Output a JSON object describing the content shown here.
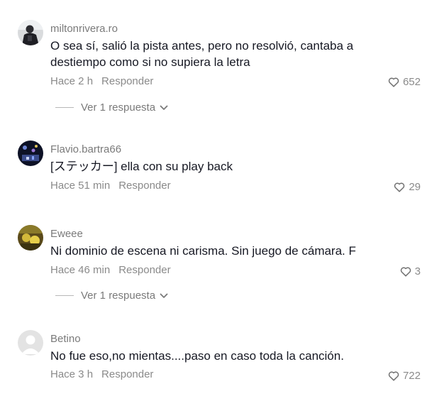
{
  "comments": [
    {
      "username": "miltonrivera.ro",
      "text": "O sea sí, salió la pista antes, pero no resolvió, cantaba a destiempo como si no supiera la letra",
      "time": "Hace 2 h",
      "reply_label": "Responder",
      "likes": "652",
      "view_replies": "Ver 1 respuesta"
    },
    {
      "username": "Flavio.bartra66",
      "text": "[ステッカー] ella con su play back",
      "time": "Hace 51 min",
      "reply_label": "Responder",
      "likes": "29"
    },
    {
      "username": "Eweee",
      "text": "Ni dominio de escena ni carisma. Sin juego de cámara. F",
      "time": "Hace 46 min",
      "reply_label": "Responder",
      "likes": "3",
      "view_replies": "Ver 1 respuesta"
    },
    {
      "username": "Betino",
      "text": "No fue eso,no mientas....paso en caso toda la canción.",
      "time": "Hace 3 h",
      "reply_label": "Responder",
      "likes": "722"
    }
  ],
  "icons": {
    "like": "heart-outline-icon",
    "expand": "chevron-down-icon"
  },
  "colors": {
    "text": "#161823",
    "secondary": "#8a8a8a"
  }
}
